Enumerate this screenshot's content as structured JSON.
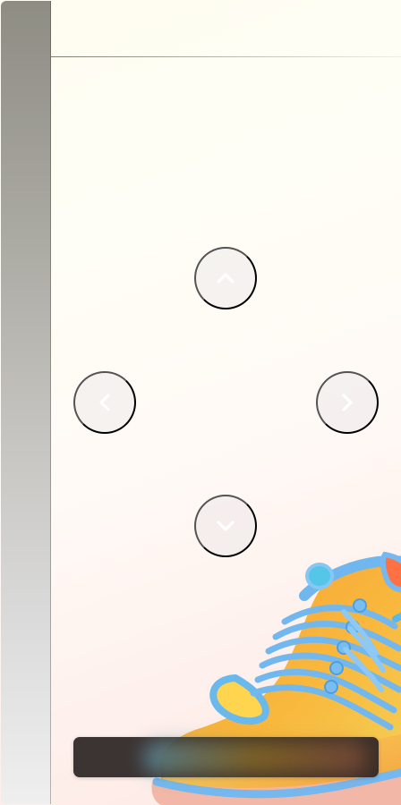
{
  "navigation": {
    "up": {
      "label": ""
    },
    "left": {
      "label": ""
    },
    "right": {
      "label": ""
    },
    "down": {
      "label": ""
    }
  },
  "footer": {
    "bar_text": ""
  },
  "colors": {
    "left_rail_top": "#8e8d84",
    "left_rail_bottom": "#efefef",
    "background_top": "#fffdf1",
    "background_bottom": "#fde8e4",
    "bottom_bar": "#2b2423",
    "shoe_orange": "#f3a03a",
    "shoe_yellow": "#f5c43f",
    "shoe_blue": "#6fb8ee"
  },
  "icons": {
    "up": "chevron-up-icon",
    "left": "chevron-left-icon",
    "right": "chevron-right-icon",
    "down": "chevron-down-icon"
  }
}
